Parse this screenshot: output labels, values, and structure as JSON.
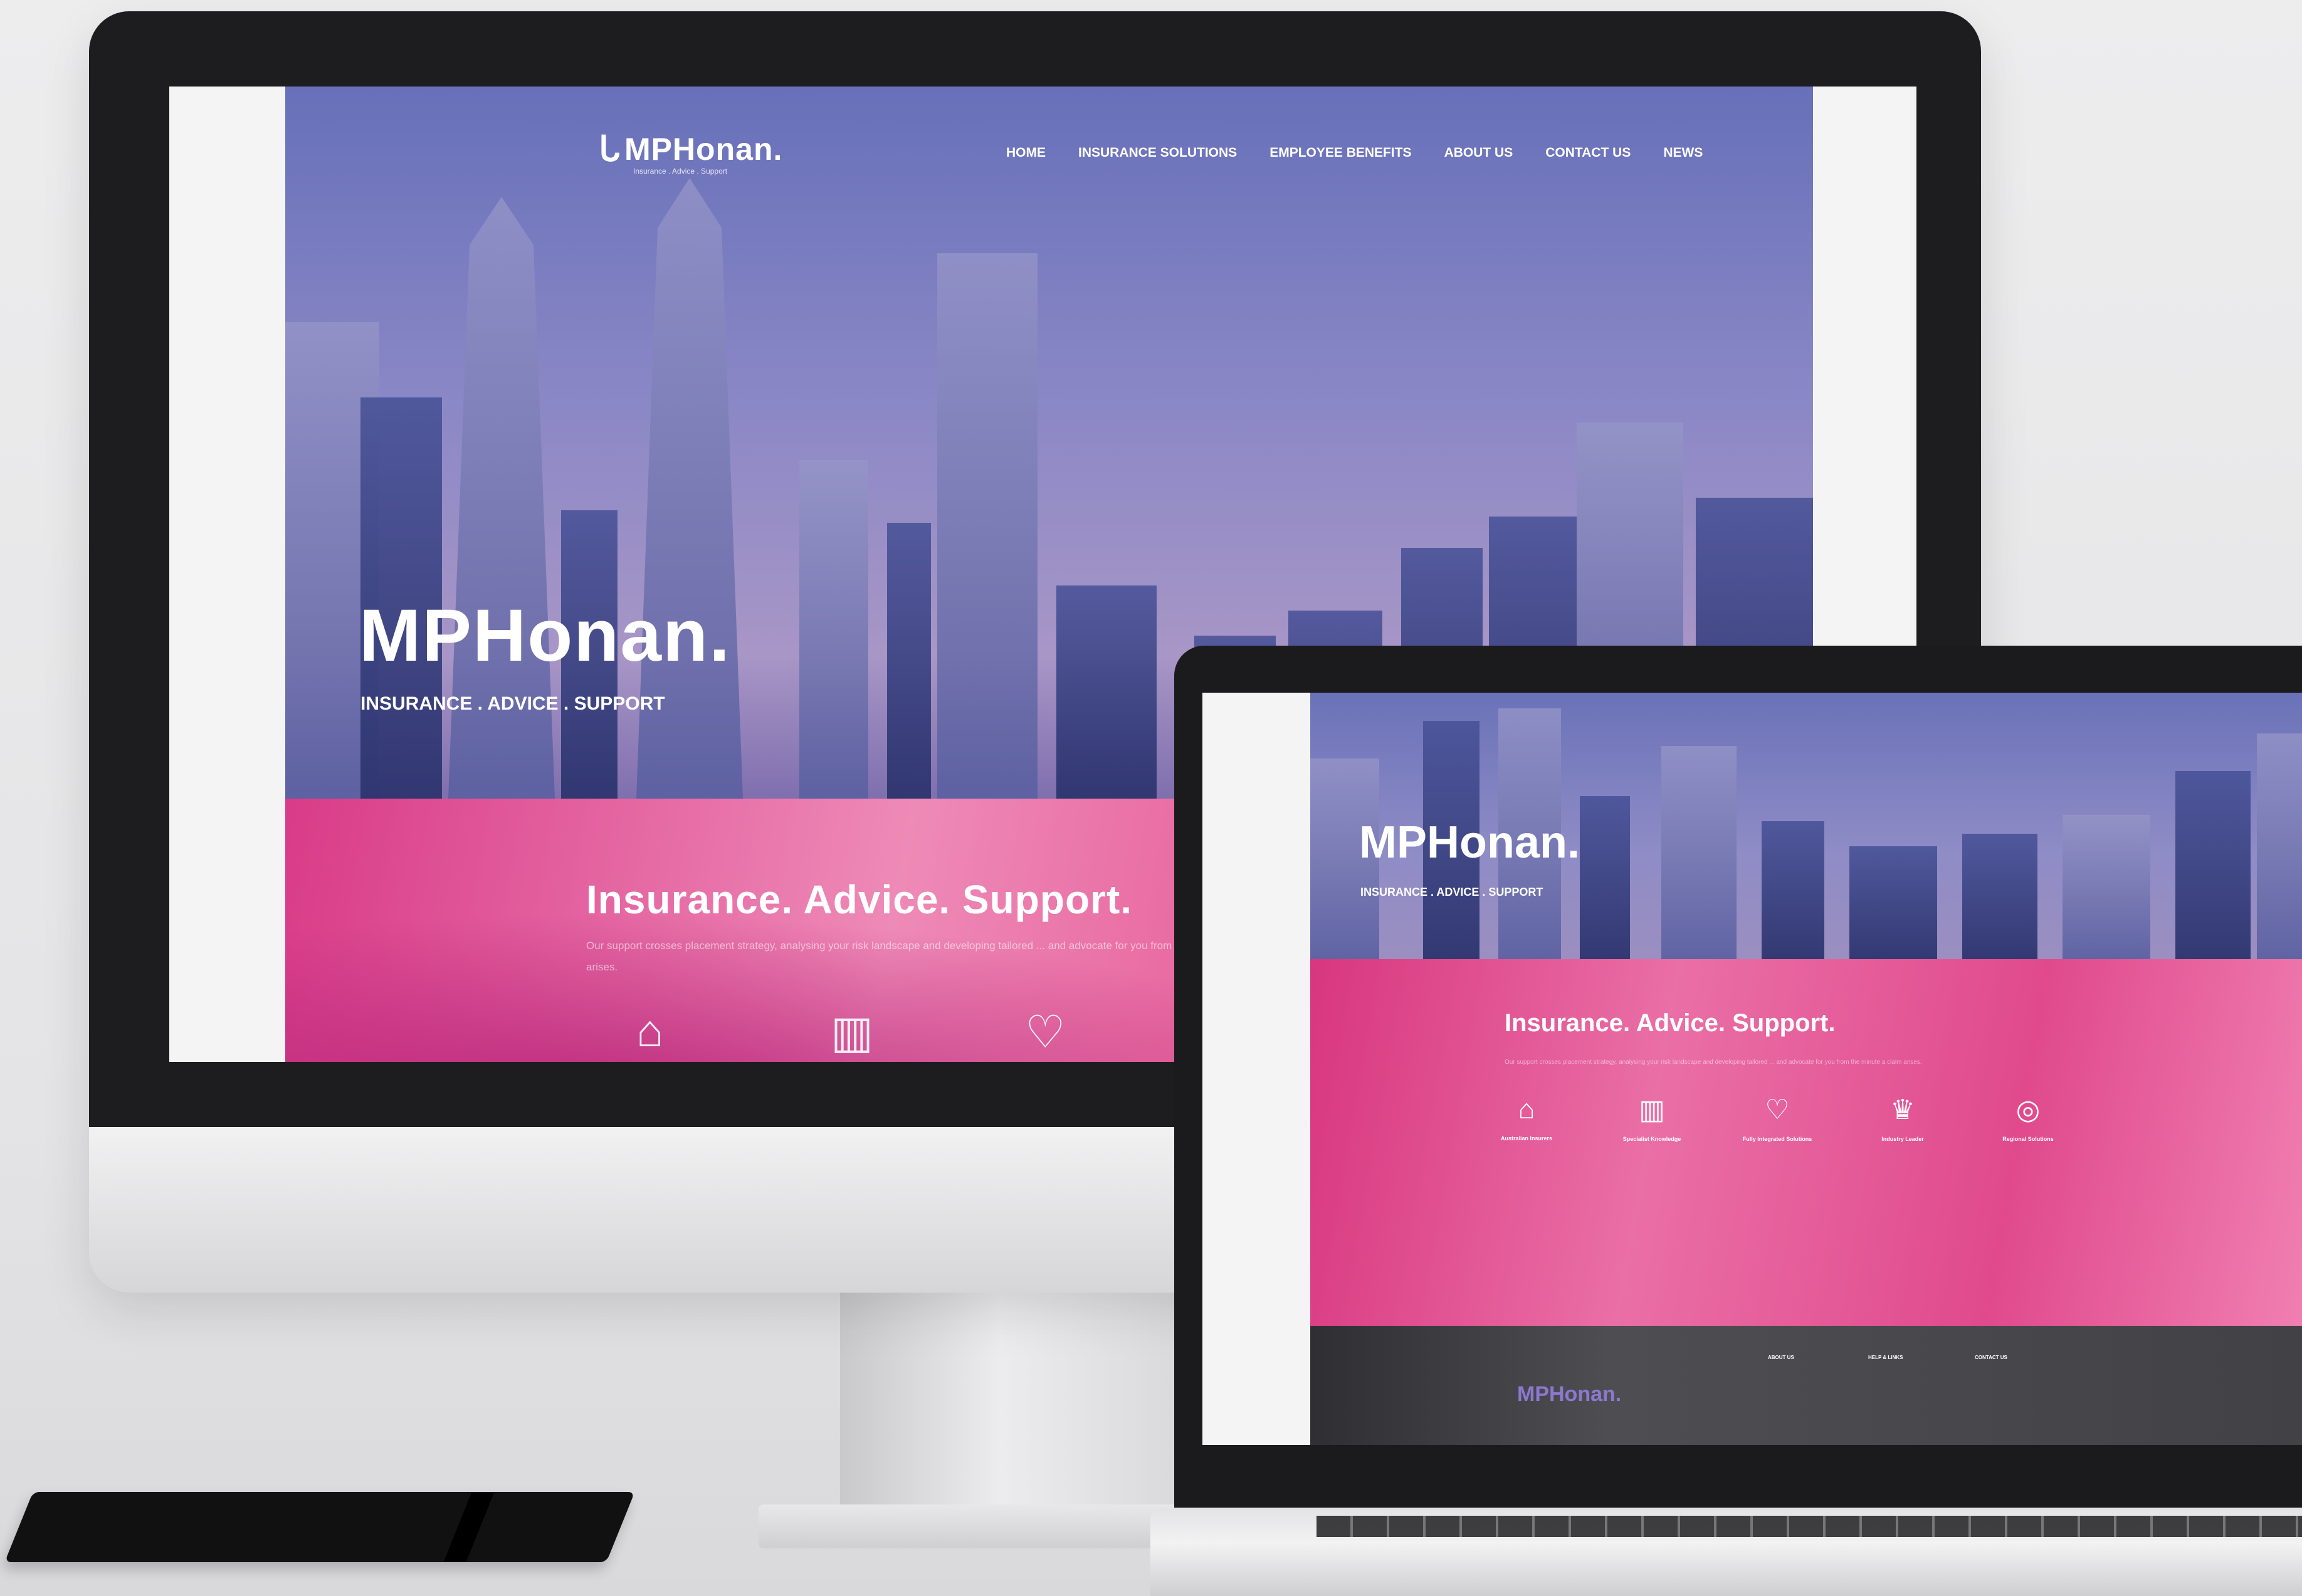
{
  "brand": {
    "logo_text": "MPHonan.",
    "tagline": "Insurance . Advice . Support"
  },
  "nav": [
    {
      "label": "HOME"
    },
    {
      "label": "INSURANCE SOLUTIONS"
    },
    {
      "label": "EMPLOYEE BENEFITS"
    },
    {
      "label": "ABOUT US"
    },
    {
      "label": "CONTACT US"
    },
    {
      "label": "NEWS"
    }
  ],
  "hero": {
    "title": "MPHonan.",
    "subtitle": "INSURANCE . ADVICE . SUPPORT"
  },
  "section": {
    "title": "Insurance. Advice. Support.",
    "intro": "Our support crosses placement strategy, analysing your risk landscape and developing tailored ... and advocate for you from the minute a claim arises."
  },
  "features": [
    {
      "title": "Australian Insurers",
      "icon": "australia-map-icon"
    },
    {
      "title": "Specialist Knowledge",
      "icon": "book-icon"
    },
    {
      "title": "Fully Integrated Solutions",
      "icon": "hand-heart-icon"
    },
    {
      "title": "Industry Leader",
      "icon": "crown-icon"
    },
    {
      "title": "Regional Solutions",
      "icon": "globe-icon"
    }
  ],
  "footer": {
    "logo_text": "MPHonan.",
    "col1_title": "ABOUT US",
    "col2_title": "HELP & LINKS",
    "col3_title": "CONTACT US"
  },
  "colors": {
    "hero_overlay": "#6f74bb",
    "accent_pink": "#e2468c",
    "footer_bg": "#3a3a3e",
    "logo_purple": "#8a79cf"
  }
}
